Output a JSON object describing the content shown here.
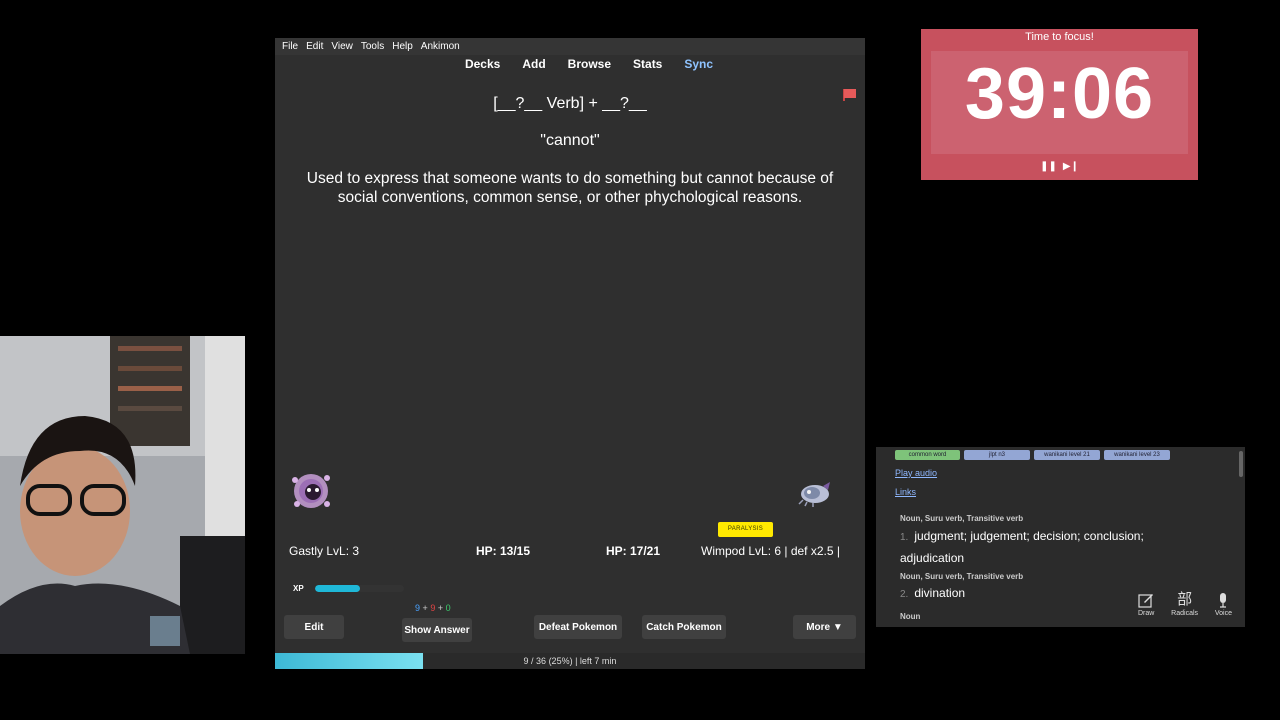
{
  "menubar": {
    "items": [
      "File",
      "Edit",
      "View",
      "Tools",
      "Help",
      "Ankimon"
    ]
  },
  "toolbar": {
    "decks": "Decks",
    "add": "Add",
    "browse": "Browse",
    "stats": "Stats",
    "sync": "Sync"
  },
  "card": {
    "pattern": "[__?__ Verb] + __?__",
    "meaning": "\"cannot\"",
    "description": "Used to express that someone wants to do something but cannot because of social conventions, common sense, or other phychological reasons."
  },
  "battle": {
    "player_name": "Gastly LvL: 3",
    "player_hp": "HP: 13/15",
    "enemy_hp": "HP: 17/21",
    "enemy_name": "Wimpod LvL: 6 | def x2.5 |",
    "status_badge": "PARALYSIS",
    "xp_label": "XP",
    "xp_fraction": 0.5
  },
  "counts": {
    "new": "9",
    "plus1": "+",
    "learn": "9",
    "plus2": "+",
    "review": "0"
  },
  "buttons": {
    "edit": "Edit",
    "show_answer": "Show Answer",
    "defeat": "Defeat Pokemon",
    "catch": "Catch Pokemon",
    "more": "More ▼"
  },
  "progress": {
    "text": "9 / 36 (25%) | left 7 min",
    "fraction": 0.25
  },
  "timer": {
    "title": "Time to focus!",
    "time": "39:06",
    "pause_icon": "pause-icon",
    "skip_icon": "skip-icon"
  },
  "dictionary": {
    "tags": [
      "common word",
      "jlpt n3",
      "wanikani level 21",
      "wanikani level 23"
    ],
    "play_audio": "Play audio",
    "links": "Links",
    "senses": [
      {
        "pos": "Noun, Suru verb, Transitive verb",
        "num": "1.",
        "text": "judgment; judgement; decision; conclusion; adjudication"
      },
      {
        "pos": "Noun, Suru verb, Transitive verb",
        "num": "2.",
        "text": "divination"
      },
      {
        "pos": "Noun",
        "num": "",
        "text": ""
      }
    ],
    "tools": {
      "draw": "Draw",
      "radicals": "Radicals",
      "voice": "Voice",
      "radicals_glyph": "部"
    }
  },
  "colors": {
    "anki_bg": "#2f2f2f",
    "timer_bg": "#c7515e",
    "sync_blue": "#8fc3ff",
    "progress": "#3db9d6",
    "xp": "#1fb8d8",
    "badge": "#ffe900"
  }
}
